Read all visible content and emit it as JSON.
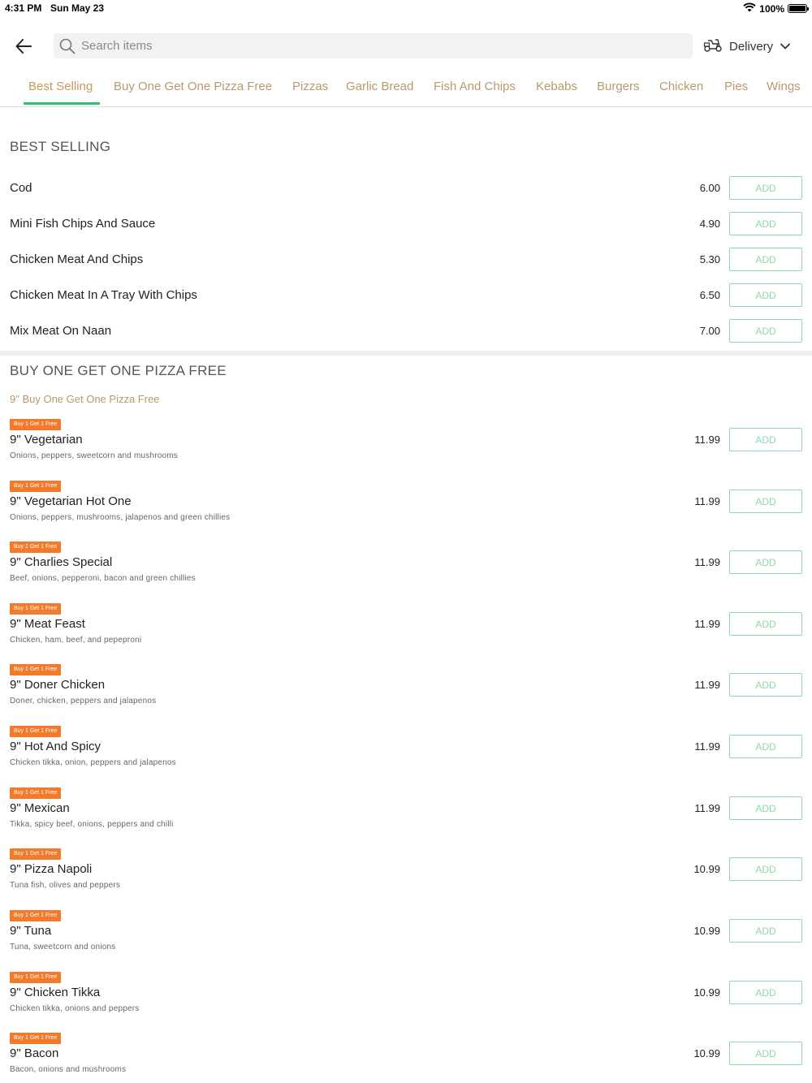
{
  "status_bar": {
    "time": "4:31 PM",
    "date": "Sun May 23",
    "battery": "100%"
  },
  "search": {
    "placeholder": "Search items"
  },
  "delivery": {
    "label": "Delivery"
  },
  "tabs": [
    {
      "label": "Best Selling",
      "active": true
    },
    {
      "label": "Buy One Get One Pizza Free"
    },
    {
      "label": "Pizzas"
    },
    {
      "label": "Garlic Bread"
    },
    {
      "label": "Fish And Chips"
    },
    {
      "label": "Kebabs"
    },
    {
      "label": "Burgers"
    },
    {
      "label": "Chicken"
    },
    {
      "label": "Pies"
    },
    {
      "label": "Wings"
    }
  ],
  "best_selling": {
    "title": "BEST SELLING",
    "items": [
      {
        "name": "Cod",
        "price": "6.00",
        "button": "ADD"
      },
      {
        "name": "Mini Fish Chips And Sauce",
        "price": "4.90",
        "button": "ADD"
      },
      {
        "name": "Chicken Meat And Chips",
        "price": "5.30",
        "button": "ADD"
      },
      {
        "name": "Chicken Meat In A Tray With Chips",
        "price": "6.50",
        "button": "ADD"
      },
      {
        "name": "Mix Meat On Naan",
        "price": "7.00",
        "button": "ADD"
      }
    ]
  },
  "bogof": {
    "title": "BUY ONE GET ONE PIZZA FREE",
    "subcategory": "9\" Buy One Get One Pizza Free",
    "items": [
      {
        "badge": "Buy 1 Get 1 Free",
        "name": "9\" Vegetarian",
        "desc": "Onions, peppers, sweetcorn and mushrooms",
        "price": "11.99",
        "button": "ADD"
      },
      {
        "badge": "Buy 1 Get 1 Free",
        "name": "9\" Vegetarian Hot One",
        "desc": "Onions, peppers, mushrooms, jalapenos and green chillies",
        "price": "11.99",
        "button": "ADD"
      },
      {
        "badge": "Buy 1 Get 1 Free",
        "name": "9\" Charlies Special",
        "desc": "Beef, onions, pepperoni, bacon and green chillies",
        "price": "11.99",
        "button": "ADD"
      },
      {
        "badge": "Buy 1 Get 1 Free",
        "name": "9\" Meat Feast",
        "desc": "Chicken, ham, beef, and pepeproni",
        "price": "11.99",
        "button": "ADD"
      },
      {
        "badge": "Buy 1 Get 1 Free",
        "name": "9\" Doner Chicken",
        "desc": "Doner, chicken, peppers and jalapenos",
        "price": "11.99",
        "button": "ADD"
      },
      {
        "badge": "Buy 1 Get 1 Free",
        "name": "9\" Hot And Spicy",
        "desc": "Chicken tikka, onion, peppers and jalapenos",
        "price": "11.99",
        "button": "ADD"
      },
      {
        "badge": "Buy 1 Get 1 Free",
        "name": "9\" Mexican",
        "desc": "Tikka, spicy beef, onions, peppers and chilli",
        "price": "11.99",
        "button": "ADD"
      },
      {
        "badge": "Buy 1 Get 1 Free",
        "name": "9\" Pizza Napoli",
        "desc": "Tuna fish, olives and peppers",
        "price": "10.99",
        "button": "ADD"
      },
      {
        "badge": "Buy 1 Get 1 Free",
        "name": "9\" Tuna",
        "desc": "Tuna, sweetcorn and onions",
        "price": "10.99",
        "button": "ADD"
      },
      {
        "badge": "Buy 1 Get 1 Free",
        "name": "9\" Chicken Tikka",
        "desc": "Chicken tikka, onions and peppers",
        "price": "10.99",
        "button": "ADD"
      },
      {
        "badge": "Buy 1 Get 1 Free",
        "name": "9\" Bacon",
        "desc": "Bacon, onions and mushrooms",
        "price": "10.99",
        "button": "ADD"
      }
    ]
  },
  "colors": {
    "accent_green": "#2ebf6e",
    "tab_text": "#b89a6c",
    "badge_orange": "#f27a2a",
    "add_button": "#8fd8ab"
  },
  "icons": {
    "back": "arrow-left-icon",
    "search": "search-icon",
    "delivery": "scooter-icon",
    "dropdown": "chevron-down-icon",
    "wifi": "wifi-icon",
    "battery": "battery-icon"
  }
}
